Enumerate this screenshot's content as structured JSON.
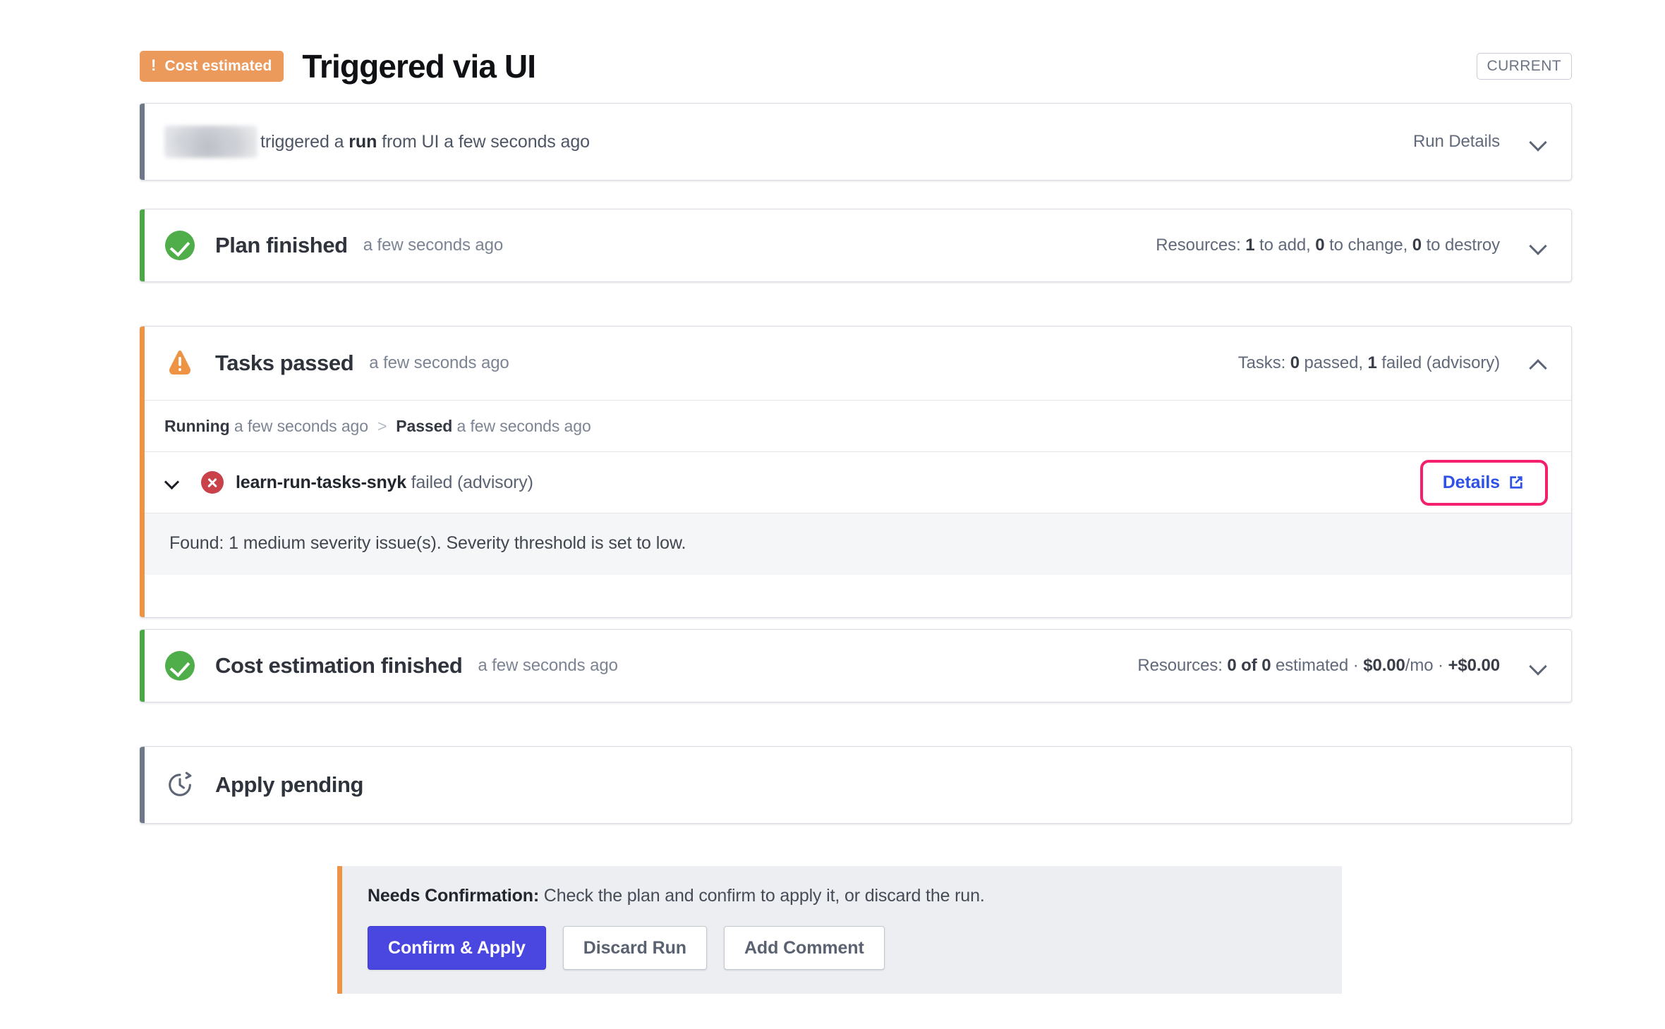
{
  "header": {
    "status_badge": {
      "icon": "exclamation-icon",
      "label": "Cost estimated"
    },
    "title": "Triggered via UI",
    "current_badge": "CURRENT"
  },
  "stages": {
    "trigger": {
      "text_before": "triggered a ",
      "text_bold": "run",
      "text_after": " from UI a few seconds ago",
      "action_label": "Run Details",
      "chevron": "chevron-down-icon"
    },
    "plan": {
      "icon": "check-circle-icon",
      "title": "Plan finished",
      "time": "a few seconds ago",
      "summary_prefix": "Resources: ",
      "summary_add": "1",
      "summary_mid1": " to add, ",
      "summary_change": "0",
      "summary_mid2": " to change, ",
      "summary_destroy": "0",
      "summary_suffix": " to destroy",
      "chevron": "chevron-down-icon"
    },
    "tasks": {
      "icon": "warning-triangle-icon",
      "title": "Tasks passed",
      "time": "a few seconds ago",
      "summary_prefix": "Tasks: ",
      "summary_passed": "0",
      "summary_mid": " passed, ",
      "summary_failed": "1",
      "summary_suffix": " failed (advisory)",
      "chevron": "chevron-up-icon",
      "breadcrumb": {
        "step1_label": "Running",
        "step1_time": " a few seconds ago",
        "separator": ">",
        "step2_label": "Passed",
        "step2_time": " a few seconds ago"
      },
      "task_item": {
        "chevron": "chevron-down-icon",
        "status_icon": "error-circle-icon",
        "name": "learn-run-tasks-snyk",
        "status_text": " failed (advisory)",
        "details_label": "Details",
        "details_icon": "external-link-icon"
      },
      "output": "Found: 1 medium severity issue(s). Severity threshold is set to low."
    },
    "cost": {
      "icon": "check-circle-icon",
      "title": "Cost estimation finished",
      "time": "a few seconds ago",
      "summary_prefix": "Resources: ",
      "summary_count": "0 of 0",
      "summary_mid": " estimated · ",
      "summary_monthly": "$0.00",
      "summary_unit": "/mo · ",
      "summary_delta": "+$0.00",
      "chevron": "chevron-down-icon"
    },
    "apply": {
      "icon": "pending-clock-icon",
      "title": "Apply pending"
    }
  },
  "confirm_panel": {
    "label": "Needs Confirmation:",
    "message": " Check the plan and confirm to apply it, or discard the run.",
    "buttons": {
      "primary": "Confirm & Apply",
      "discard": "Discard Run",
      "comment": "Add Comment"
    }
  },
  "colors": {
    "accent_orange": "#ee9344",
    "accent_green": "#4aa845",
    "accent_grey": "#6e7888",
    "primary_button": "#4a47e0",
    "details_link": "#2f51e6",
    "highlight_box": "#f4206d",
    "error_red": "#c9424a"
  }
}
